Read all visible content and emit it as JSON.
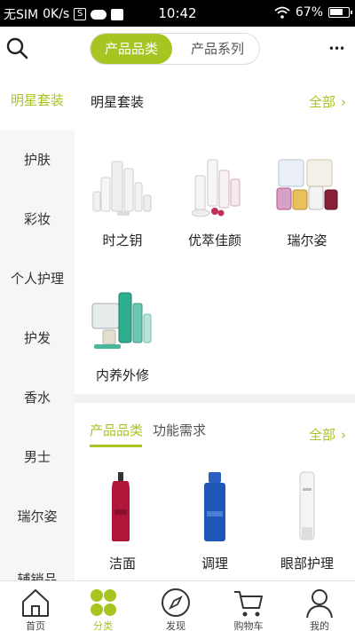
{
  "status_bar": {
    "carrier": "无SIM",
    "speed": "0K/s",
    "speed_box": "S",
    "time": "10:42",
    "battery": "67%"
  },
  "top_bar": {
    "segment_active": "产品品类",
    "segment_inactive": "产品系列",
    "more": "•••"
  },
  "sidebar": {
    "items": [
      "明星套装",
      "护肤",
      "彩妆",
      "个人护理",
      "护发",
      "香水",
      "男士",
      "瑞尔姿",
      "辅销品"
    ]
  },
  "section": {
    "title": "明星套装",
    "all_label": "全部",
    "products": [
      "时之钥",
      "优萃佳颜",
      "瑞尔姿",
      "内养外修"
    ]
  },
  "section2": {
    "tab_active": "产品品类",
    "tab_inactive": "功能需求",
    "all_label": "全部",
    "products": [
      "洁面",
      "调理",
      "眼部护理"
    ]
  },
  "bottom_nav": {
    "items": [
      "首页",
      "分类",
      "发现",
      "购物车",
      "我的"
    ]
  },
  "colors": {
    "accent": "#a7c521",
    "sidebar_bg": "#f5f6f5"
  }
}
